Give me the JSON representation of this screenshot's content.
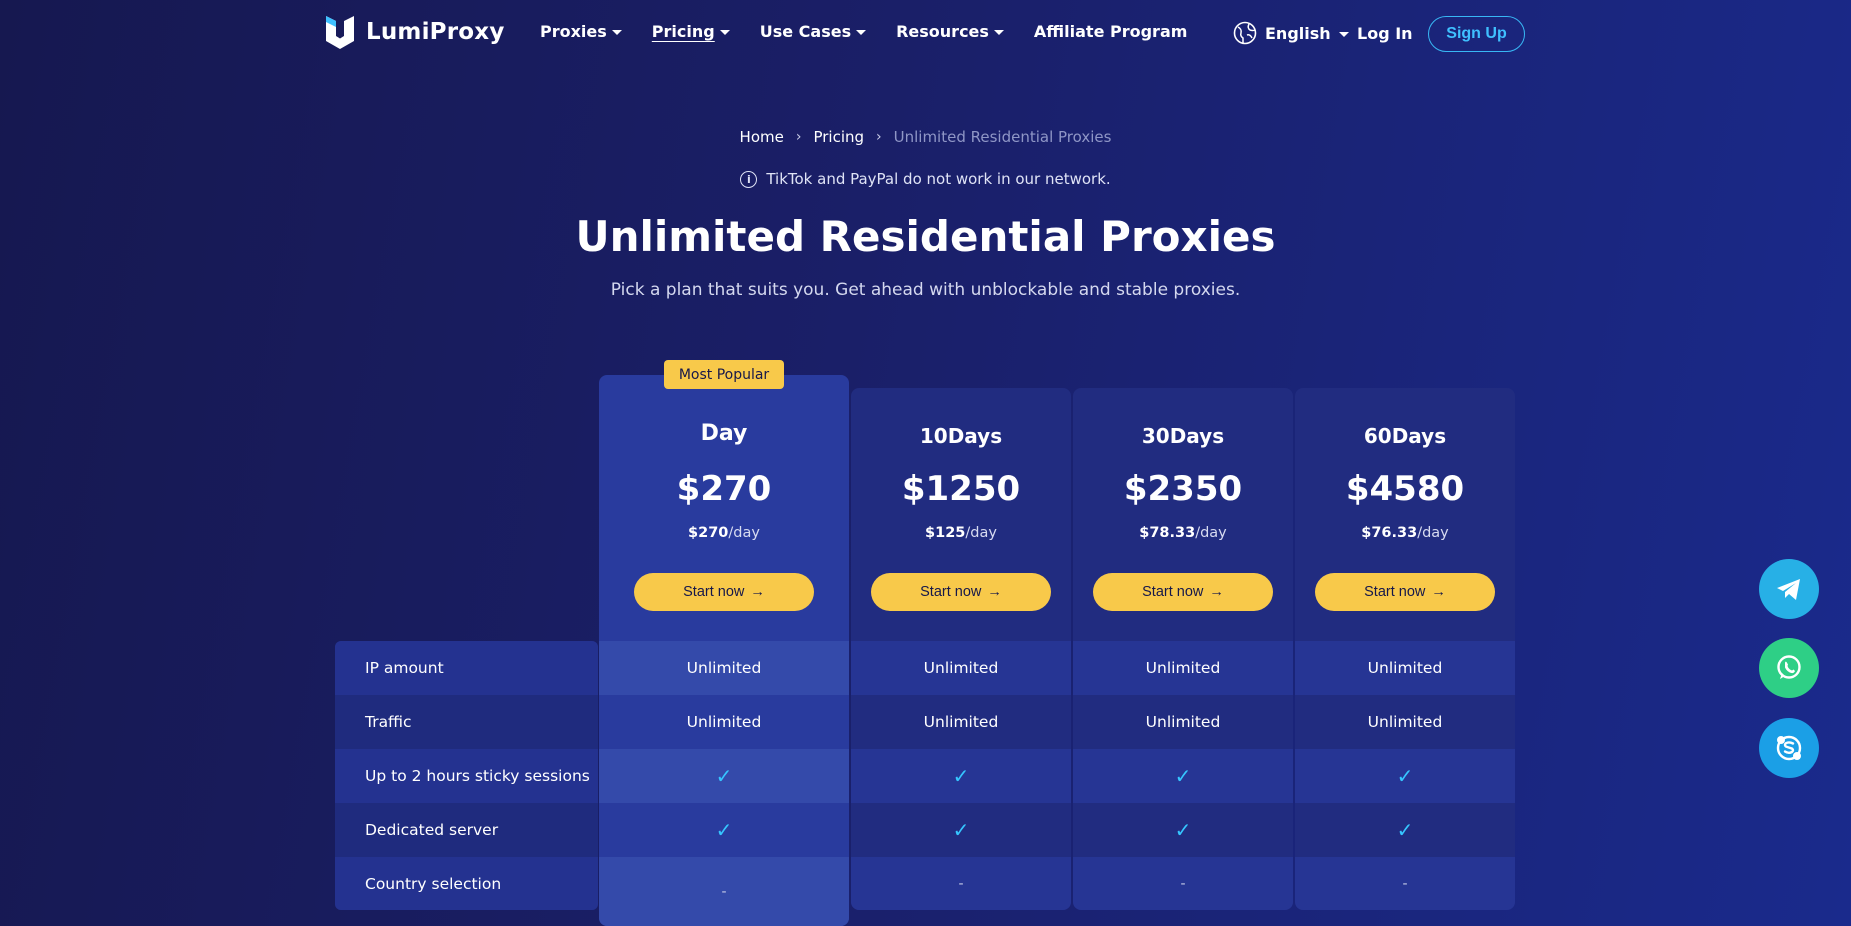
{
  "brand": {
    "name": "LumiProxy"
  },
  "nav": {
    "items": [
      {
        "label": "Proxies",
        "has_menu": true
      },
      {
        "label": "Pricing",
        "has_menu": true
      },
      {
        "label": "Use Cases",
        "has_menu": true
      },
      {
        "label": "Resources",
        "has_menu": true
      },
      {
        "label": "Affiliate Program",
        "has_menu": false
      }
    ],
    "active": "Pricing",
    "language": "English",
    "login": "Log In",
    "signup": "Sign Up"
  },
  "breadcrumb": {
    "items": [
      "Home",
      "Pricing"
    ],
    "current": "Unlimited Residential Proxies"
  },
  "notice": "TikTok and PayPal do not work in our network.",
  "hero": {
    "title": "Unlimited Residential Proxies",
    "subtitle": "Pick a plan that suits you. Get ahead with unblockable and stable proxies."
  },
  "features": [
    "IP amount",
    "Traffic",
    "Up to 2 hours sticky sessions",
    "Dedicated server",
    "Country selection"
  ],
  "plans": [
    {
      "name": "Day",
      "price": "$270",
      "per_price": "$270",
      "per_unit": "/day",
      "badge": "Most Popular",
      "button": "Start now",
      "values": [
        "Unlimited",
        "Unlimited",
        "check",
        "check",
        "-"
      ]
    },
    {
      "name": "10Days",
      "price": "$1250",
      "per_price": "$125",
      "per_unit": "/day",
      "button": "Start now",
      "values": [
        "Unlimited",
        "Unlimited",
        "check",
        "check",
        "-"
      ]
    },
    {
      "name": "30Days",
      "price": "$2350",
      "per_price": "$78.33",
      "per_unit": "/day",
      "button": "Start now",
      "values": [
        "Unlimited",
        "Unlimited",
        "check",
        "check",
        "-"
      ]
    },
    {
      "name": "60Days",
      "price": "$4580",
      "per_price": "$76.33",
      "per_unit": "/day",
      "button": "Start now",
      "values": [
        "Unlimited",
        "Unlimited",
        "check",
        "check",
        "-"
      ]
    }
  ],
  "icons": {
    "check": "check-icon",
    "arrow": "arrow-right-icon",
    "info": "info-icon",
    "globe": "globe-icon",
    "social": [
      "telegram-icon",
      "whatsapp-icon",
      "skype-icon"
    ]
  },
  "colors": {
    "accent": "#f8c94a",
    "signup": "#38b7f5",
    "check": "#36c6ff",
    "background": "#1a1f68"
  }
}
